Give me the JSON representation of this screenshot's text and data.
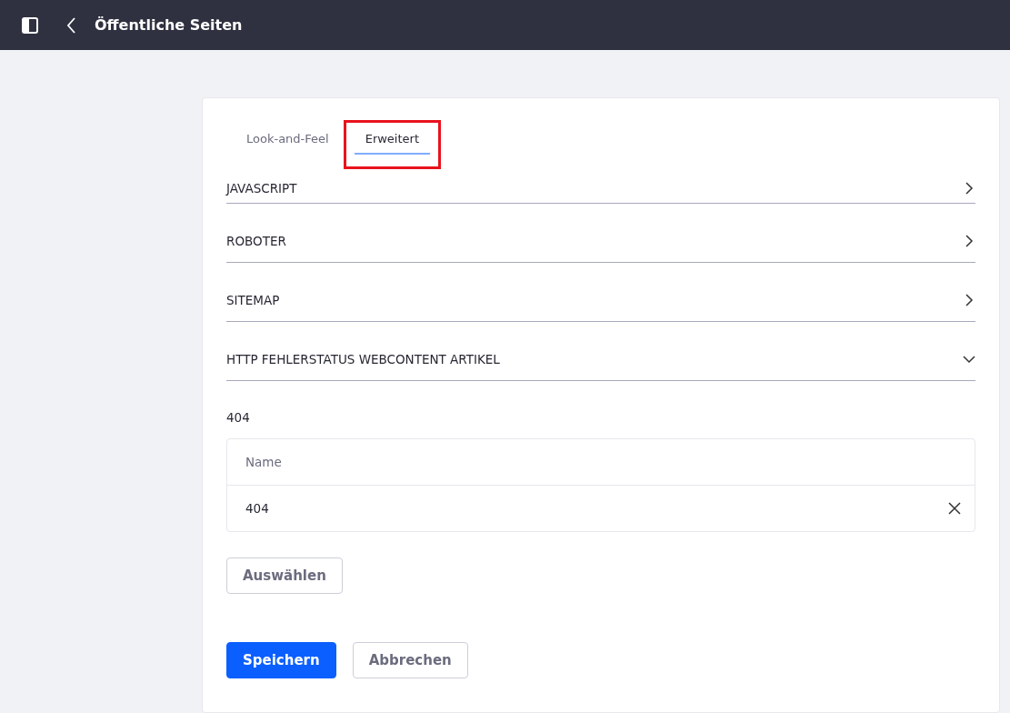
{
  "header": {
    "title": "Öffentliche Seiten"
  },
  "tabs": [
    {
      "label": "Look-and-Feel",
      "selected": false,
      "highlighted": false
    },
    {
      "label": "Erweitert",
      "selected": true,
      "highlighted": true
    }
  ],
  "sections": [
    {
      "title": "JAVASCRIPT",
      "expanded": false
    },
    {
      "title": "ROBOTER",
      "expanded": false
    },
    {
      "title": "SITEMAP",
      "expanded": false
    },
    {
      "title": "HTTP FEHLERSTATUS WEBCONTENT ARTIKEL",
      "expanded": true
    }
  ],
  "error_status": {
    "label": "404",
    "table": {
      "columns": [
        "Name"
      ],
      "rows": [
        [
          "404"
        ]
      ]
    },
    "select_button": "Auswählen"
  },
  "buttons": [
    {
      "label": "Speichern",
      "kind": "primary"
    },
    {
      "label": "Abbrechen",
      "kind": "secondary"
    }
  ]
}
